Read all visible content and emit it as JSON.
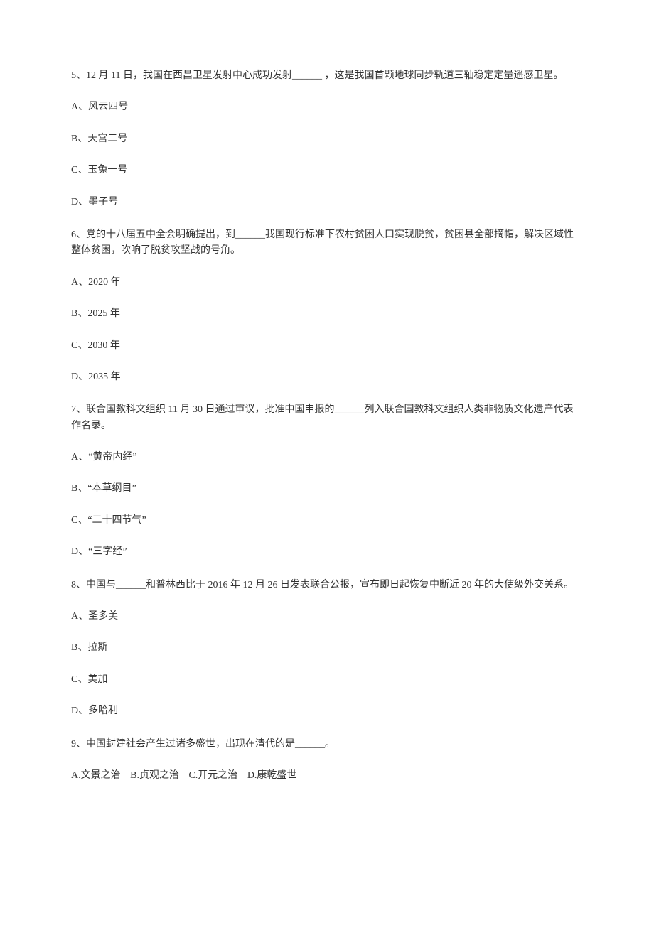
{
  "questions": [
    {
      "stem": "5、12 月 11 日，我国在西昌卫星发射中心成功发射______ ，这是我国首颗地球同步轨道三轴稳定定量遥感卫星。",
      "options": [
        "A、风云四号",
        "B、天宫二号",
        "C、玉兔一号",
        "D、墨子号"
      ]
    },
    {
      "stem": "6、党的十八届五中全会明确提出，到______我国现行标准下农村贫困人口实现脱贫，贫困县全部摘帽，解决区域性整体贫困，吹响了脱贫攻坚战的号角。",
      "options": [
        "A、2020 年",
        "B、2025 年",
        "C、2030 年",
        "D、2035 年"
      ]
    },
    {
      "stem": "7、联合国教科文组织 11 月 30 日通过审议，批准中国申报的______列入联合国教科文组织人类非物质文化遗产代表作名录。",
      "options": [
        "A、“黄帝内经”",
        "B、“本草纲目”",
        "C、“二十四节气”",
        "D、“三字经”"
      ]
    },
    {
      "stem": "8、中国与______和普林西比于 2016 年 12 月 26 日发表联合公报，宣布即日起恢复中断近 20 年的大使级外交关系。",
      "options": [
        "A、圣多美",
        "B、拉斯",
        "C、美加",
        "D、多哈利"
      ]
    },
    {
      "stem": "9、中国封建社会产生过诸多盛世，出现在清代的是______。",
      "inline": true,
      "options": [
        "A.文景之治",
        "B.贞观之治",
        "C.开元之治",
        "D.康乾盛世"
      ]
    }
  ]
}
